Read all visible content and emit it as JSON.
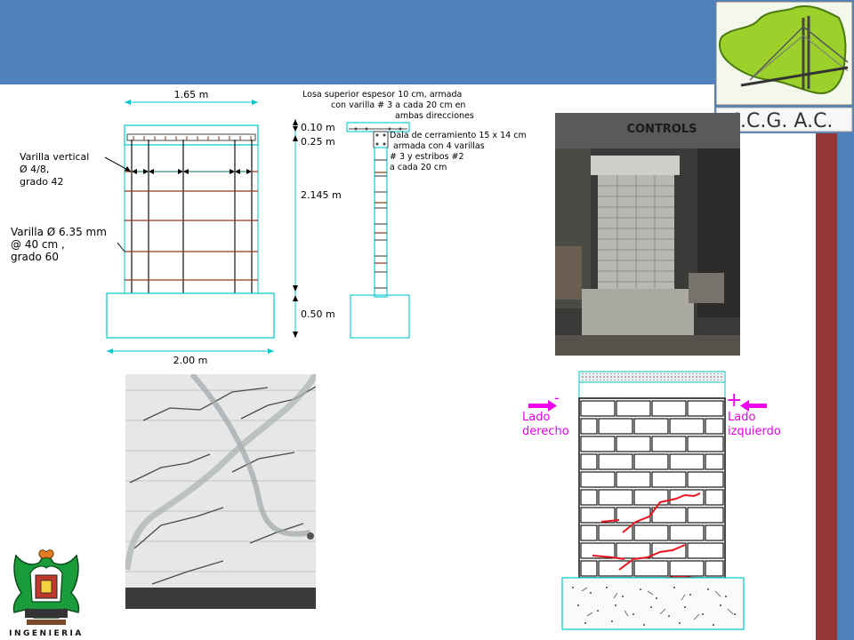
{
  "colors": {
    "header_band": "#4f81bd",
    "side_red": "#943634",
    "side_blue": "#4f81bd",
    "drawing_cyan": "#00c8c8",
    "rebar_brown": "#8b3a1a",
    "crack_red": "#e8141e",
    "force_magenta": "#ee00ee"
  },
  "logo": {
    "org_name": "I.C.G. A.C.",
    "emblem_icon": "state-map-bridge-icon"
  },
  "drawing": {
    "dim_top": "1.65 m",
    "dim_bottom": "2.00 m",
    "note_vertical_bar": [
      "Varilla vertical",
      "Ø 4/8,",
      "grado 42"
    ],
    "note_horizontal_bar": [
      "Varilla Ø 6.35 mm",
      "@ 40 cm ,",
      "grado 60"
    ],
    "section_dims": [
      "0.10 m",
      "0.25 m",
      "2.145 m",
      "0.50 m"
    ],
    "slab_note": [
      "Losa superior espesor 10 cm, armada",
      "con varilla # 3 a cada 20 cm en",
      "ambas direcciones"
    ],
    "beam_note": [
      "Dala de cerramiento 15 x 14 cm",
      "armada con 4 varillas",
      "# 3 y estribos #2",
      "a cada 20 cm"
    ]
  },
  "photos": {
    "wall_photo_sign": "CONTROLS"
  },
  "test_diagram": {
    "minus_sign": "-",
    "plus_sign": "+",
    "left_label": [
      "Lado",
      "derecho"
    ],
    "right_label": [
      "Lado",
      "izquierdo"
    ]
  },
  "faculty_logo": {
    "caption": "INGENIERIA",
    "emblem_icon": "eagle-crest-icon"
  }
}
